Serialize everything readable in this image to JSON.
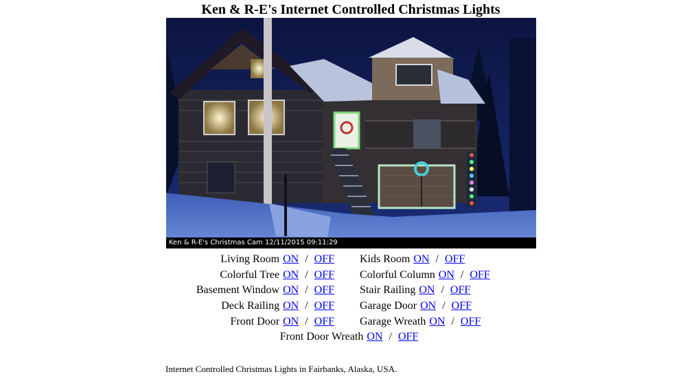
{
  "page": {
    "title": "Ken & R-E's Internet Controlled Christmas Lights",
    "footer": "Internet Controlled Christmas Lights in Fairbanks, Alaska, USA."
  },
  "webcam": {
    "caption": "Ken & R-E's Christmas Cam 12/11/2015 09:11:29"
  },
  "controls": {
    "on_label": "ON",
    "off_label": "OFF",
    "separator": "/",
    "rows": [
      {
        "left": "Living Room",
        "right": "Kids Room"
      },
      {
        "left": "Colorful Tree",
        "right": "Colorful Column"
      },
      {
        "left": "Basement Window",
        "right": "Stair Railing"
      },
      {
        "left": "Deck Railing",
        "right": "Garage Door"
      },
      {
        "left": "Front Door",
        "right": "Garage Wreath"
      }
    ],
    "last": "Front Door Wreath"
  },
  "colors": {
    "link": "#0000ee",
    "caption_bg": "#000000",
    "caption_text": "#ffffff"
  }
}
